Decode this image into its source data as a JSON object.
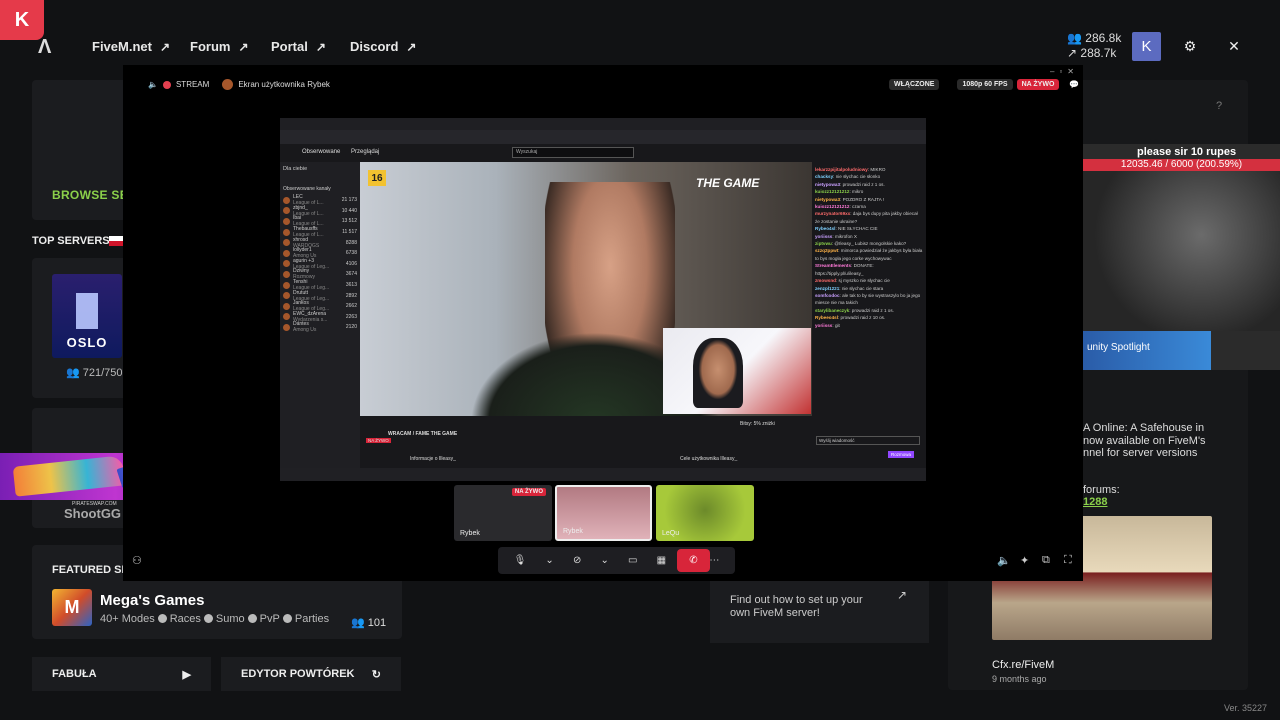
{
  "topbar": {
    "logo_letter": "K",
    "nav": [
      {
        "label": "FiveM.net"
      },
      {
        "label": "Forum"
      },
      {
        "label": "Portal"
      },
      {
        "label": "Discord"
      }
    ],
    "stat_players": "286.8k",
    "stat_servers": "288.7k",
    "avatar_letter": "K"
  },
  "home": {
    "browse_servers": "BROWSE SERVERS",
    "top_servers": "TOP SERVERS",
    "oslo_label": "OSLO",
    "oslo_players": "721/750",
    "shoot_label": "ShootGG",
    "pirate_label": "PIRATESWAP.COM",
    "featured_label": "FEATURED SERVER",
    "featured_server": {
      "title": "Mega's Games",
      "tags": [
        "40+ Modes",
        "Races",
        "Sumo",
        "PvP",
        "Parties"
      ],
      "count": "101"
    },
    "btn_story": "FABUŁA",
    "btn_replay": "EDYTOR POWTÓREK",
    "setup_text_1": "Find out how to set up your",
    "setup_text_2": "own FiveM server!",
    "news_lines": [
      "A Online: A Safehouse in",
      "now available on FiveM's",
      "nnel for server versions"
    ],
    "forums_label": "forums:",
    "forums_link": "1288",
    "cfx_title": "Cfx.re/FiveM",
    "cfx_sub": "9 months ago",
    "version": "Ver. 35227",
    "right_stream": {
      "title": "please sir 10 rupes",
      "progress_text": "12035.46 / 6000 (200.59%)",
      "progress_pct": 100,
      "spotlight": "unity Spotlight"
    }
  },
  "overlay": {
    "stream_label": "STREAM",
    "screen_owner": "Ekran użytkownika Rybek",
    "enabled_label": "WŁĄCZONE",
    "quality_label": "1080p 60 FPS",
    "live_label": "NA ŻYWO",
    "browser": {
      "followed": "Obserwowane",
      "browse": "Przeglądaj",
      "search_placeholder": "Wyszukaj",
      "for_you": "Dla ciebie",
      "followed_channels": "Obserwowane kanały",
      "age_rating": "16",
      "game_logo": "THE GAME",
      "channels": [
        {
          "name": "LEC",
          "game": "League of L...",
          "viewers": "21 173"
        },
        {
          "name": "zbjnd_",
          "game": "League of L...",
          "viewers": "10 440"
        },
        {
          "name": "Ibai",
          "game": "League of L...",
          "viewers": "13 512"
        },
        {
          "name": "Thebausffs",
          "game": "League of L...",
          "viewers": "11 517"
        },
        {
          "name": "xhrosd",
          "game": "WARDOGS",
          "viewers": "8288"
        },
        {
          "name": "lollyder1",
          "game": "Among Us",
          "viewers": "6738"
        },
        {
          "name": "agurin +3",
          "game": "League of Leg...",
          "viewers": "4106"
        },
        {
          "name": "Dziwny",
          "game": "Rozmowy",
          "viewers": "3674"
        },
        {
          "name": "Tenshi",
          "game": "League of Leg...",
          "viewers": "3613"
        },
        {
          "name": "Drututt",
          "game": "League of Leg...",
          "viewers": "2892"
        },
        {
          "name": "Jankos",
          "game": "League of Leg...",
          "viewers": "2662"
        },
        {
          "name": "EWC_dzArena",
          "game": "Wydarzenia s...",
          "viewers": "2263"
        },
        {
          "name": "Dantes",
          "game": "Among Us",
          "viewers": "2120"
        }
      ],
      "stream_title": "WRACAM / FAME THE GAME",
      "live_badge": "NA ŻYWO",
      "tab_info": "Informacje o Illeasy_",
      "tab_goals": "Cele użytkownika Illeasy_",
      "bits_label": "Bitsy: 5% zniżki",
      "chat_lines": [
        {
          "user": "lekarzzpijitalpoludniowy",
          "msg": "MIKRO"
        },
        {
          "user": "chacksy",
          "msg": "nie słychac cie słonko"
        },
        {
          "user": "nietypowa3",
          "msg": "prowadzi raid z 1 os."
        },
        {
          "user": "kuiozz12121212",
          "msg": "mikro"
        },
        {
          "user": "nietypowa3",
          "msg": "POZDRO Z RAJTA !"
        },
        {
          "user": "kuiozz12121212",
          "msg": "czarna"
        },
        {
          "user": "murzynator69xx",
          "msg": "daja bys dupy pita jakby obiecał że zostanie ukraine?"
        },
        {
          "user": "Rybeo4sl",
          "msg": "NIE SŁYCHAC CIE"
        },
        {
          "user": "yoriisss",
          "msg": "mikrofon X"
        },
        {
          "user": "ziptvwu",
          "msg": "@Ileasy_ Lubisz mongolskie kako?"
        },
        {
          "user": "szzq2ppwt",
          "msg": "mimorca powiedział że jakbys była biała to bys mogła jego corke wychowywac"
        },
        {
          "user": "StreamElements",
          "msg": "DONATE: https://tipply.pl/u/ileasy_"
        },
        {
          "user": "zmowsnd",
          "msg": "sj myszko nie słychac cie"
        },
        {
          "user": "zenzpl1221",
          "msg": "nie słychac cie stara"
        },
        {
          "user": "somfcodoc",
          "msg": "ale tak to by sie wystraszylo bo ja jego miesce nie ma takich"
        },
        {
          "user": "starylibaneczyk",
          "msg": "prowadzi raid z 1 os."
        },
        {
          "user": "Rybeeo4sl",
          "msg": "prowadzi raid z 10 os."
        },
        {
          "user": "yoriisss",
          "msg": "git"
        }
      ],
      "chat_placeholder": "Wyślij wiadomość",
      "chat_button": "Rozmowa"
    },
    "participants": [
      {
        "name": "Rybek",
        "badge": "NA ŻYWO"
      },
      {
        "name": "Rybek"
      },
      {
        "name": "LeQu"
      }
    ]
  }
}
